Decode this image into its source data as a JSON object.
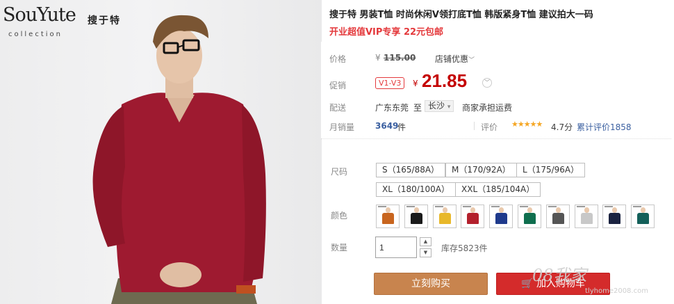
{
  "brand": {
    "logo": "SouYute",
    "cn": "搜于特",
    "sub": "collection"
  },
  "product": {
    "title": "搜于特 男装T恤 时尚休闲V领打底T恤 韩版紧身T恤 建议拍大一码",
    "promo": "开业超值VIP专享 22元包邮"
  },
  "price": {
    "label": "价格",
    "currency": "¥",
    "original": "115.00",
    "store_discount": "店铺优惠",
    "promo_label": "促销",
    "vip_badge": "V1-V3",
    "promo_price": "21.85"
  },
  "shipping": {
    "label": "配送",
    "from": "广东东莞",
    "to_word": "至",
    "city": "长沙",
    "fee": "商家承担运费"
  },
  "sales": {
    "label": "月销量",
    "count": "3649",
    "unit": "件",
    "rating_label": "评价",
    "stars": "★★★★★",
    "score": "4.7分",
    "reviews": "累计评价1858"
  },
  "sizes": {
    "label": "尺码",
    "options": [
      "S（165/88A）",
      "M（170/92A）",
      "L（175/96A）",
      "XL（180/100A）",
      "XXL（185/104A）"
    ]
  },
  "colors": {
    "label": "颜色",
    "swatches": [
      "#c8651e",
      "#1a1a1a",
      "#e8b82a",
      "#b3202c",
      "#1f3a8c",
      "#0f6e4e",
      "#555555",
      "#c8c8c8",
      "#1b2340",
      "#14605a"
    ]
  },
  "quantity": {
    "label": "数量",
    "value": "1",
    "stock": "库存5823件",
    "up": "▲",
    "down": "▼"
  },
  "buttons": {
    "buy": "立刻购买",
    "cart": "加入购物车"
  },
  "watermark": {
    "main": "08我家",
    "sub": "tlyhome2008.com"
  }
}
